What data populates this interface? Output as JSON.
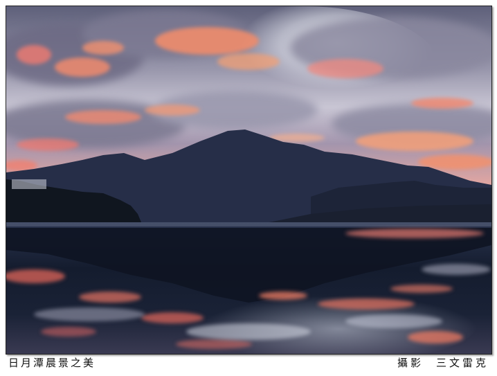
{
  "photo": {
    "subject": "mountain-lake-sunrise-photo"
  },
  "caption": {
    "title": "日月潭晨景之美",
    "credit_label": "攝影",
    "photographer": "三文雷克"
  },
  "colors": {
    "sky_light": "#e9ecf3",
    "cloud_gray": "#8c8aa0",
    "cloud_pink": "#f07f70",
    "cloud_orange": "#f4a070",
    "mountain": "#232b44",
    "water_dark": "#121a2c",
    "water_pink": "#e26a60"
  }
}
